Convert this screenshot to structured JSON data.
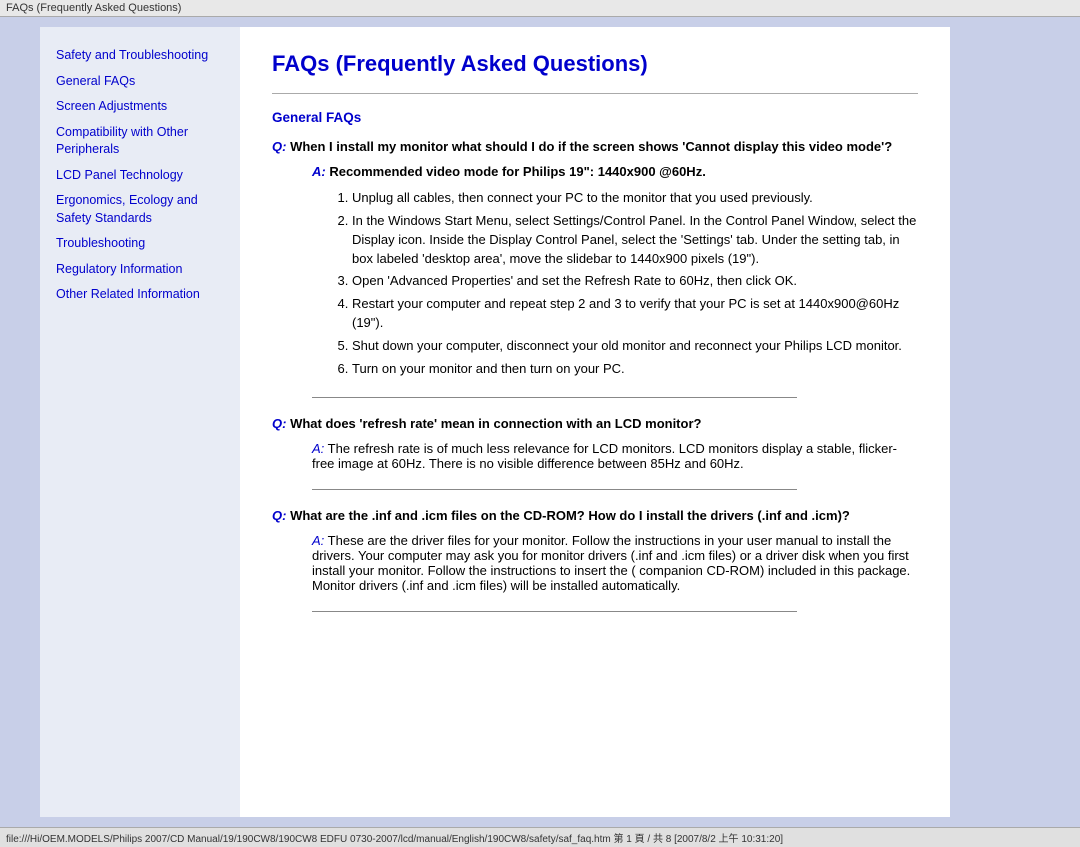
{
  "titleBar": {
    "text": "FAQs (Frequently Asked Questions)"
  },
  "sidebar": {
    "links": [
      {
        "label": "Safety and Troubleshooting",
        "name": "sidebar-safety"
      },
      {
        "label": "General FAQs",
        "name": "sidebar-general-faqs"
      },
      {
        "label": "Screen Adjustments",
        "name": "sidebar-screen-adjustments"
      },
      {
        "label": "Compatibility with Other Peripherals",
        "name": "sidebar-compatibility"
      },
      {
        "label": "LCD Panel Technology",
        "name": "sidebar-lcd-panel"
      },
      {
        "label": "Ergonomics, Ecology and Safety Standards",
        "name": "sidebar-ergonomics"
      },
      {
        "label": "Troubleshooting",
        "name": "sidebar-troubleshooting"
      },
      {
        "label": "Regulatory Information",
        "name": "sidebar-regulatory"
      },
      {
        "label": "Other Related Information",
        "name": "sidebar-other"
      }
    ]
  },
  "main": {
    "title": "FAQs (Frequently Asked Questions)",
    "sectionHeading": "General FAQs",
    "qa": [
      {
        "question": "Q: When I install my monitor what should I do if the screen shows 'Cannot display this video mode'?",
        "answerHeading": "A: Recommended video mode for Philips 19\": 1440x900 @60Hz.",
        "steps": [
          "Unplug all cables, then connect your PC to the monitor that you used previously.",
          "In the Windows Start Menu, select Settings/Control Panel. In the Control Panel Window, select the Display icon. Inside the Display Control Panel, select the 'Settings' tab. Under the setting tab, in box labeled 'desktop area', move the slidebar to 1440x900 pixels (19\").",
          "Open 'Advanced Properties' and set the Refresh Rate to 60Hz, then click OK.",
          "Restart your computer and repeat step 2 and 3 to verify that your PC is set at 1440x900@60Hz (19\").",
          "Shut down your computer, disconnect your old monitor and reconnect your Philips LCD monitor.",
          "Turn on your monitor and then turn on your PC."
        ]
      },
      {
        "question": "Q: What does 'refresh rate' mean in connection with an LCD monitor?",
        "answerText": "A: The refresh rate is of much less relevance for LCD monitors. LCD monitors display a stable, flicker-free image at 60Hz. There is no visible difference between 85Hz and 60Hz."
      },
      {
        "question": "Q: What are the .inf and .icm files on the CD-ROM? How do I install the drivers (.inf and .icm)?",
        "answerText": "A: These are the driver files for your monitor. Follow the instructions in your user manual to install the drivers. Your computer may ask you for monitor drivers (.inf and .icm files) or a driver disk when you first install your monitor. Follow the instructions to insert the ( companion CD-ROM) included in this package. Monitor drivers (.inf and .icm files) will be installed automatically."
      }
    ]
  },
  "statusBar": {
    "text": "file:///Hi/OEM.MODELS/Philips 2007/CD Manual/19/190CW8/190CW8 EDFU 0730-2007/lcd/manual/English/190CW8/safety/saf_faq.htm 第 1 頁 / 共 8 [2007/8/2 上午 10:31:20]"
  }
}
